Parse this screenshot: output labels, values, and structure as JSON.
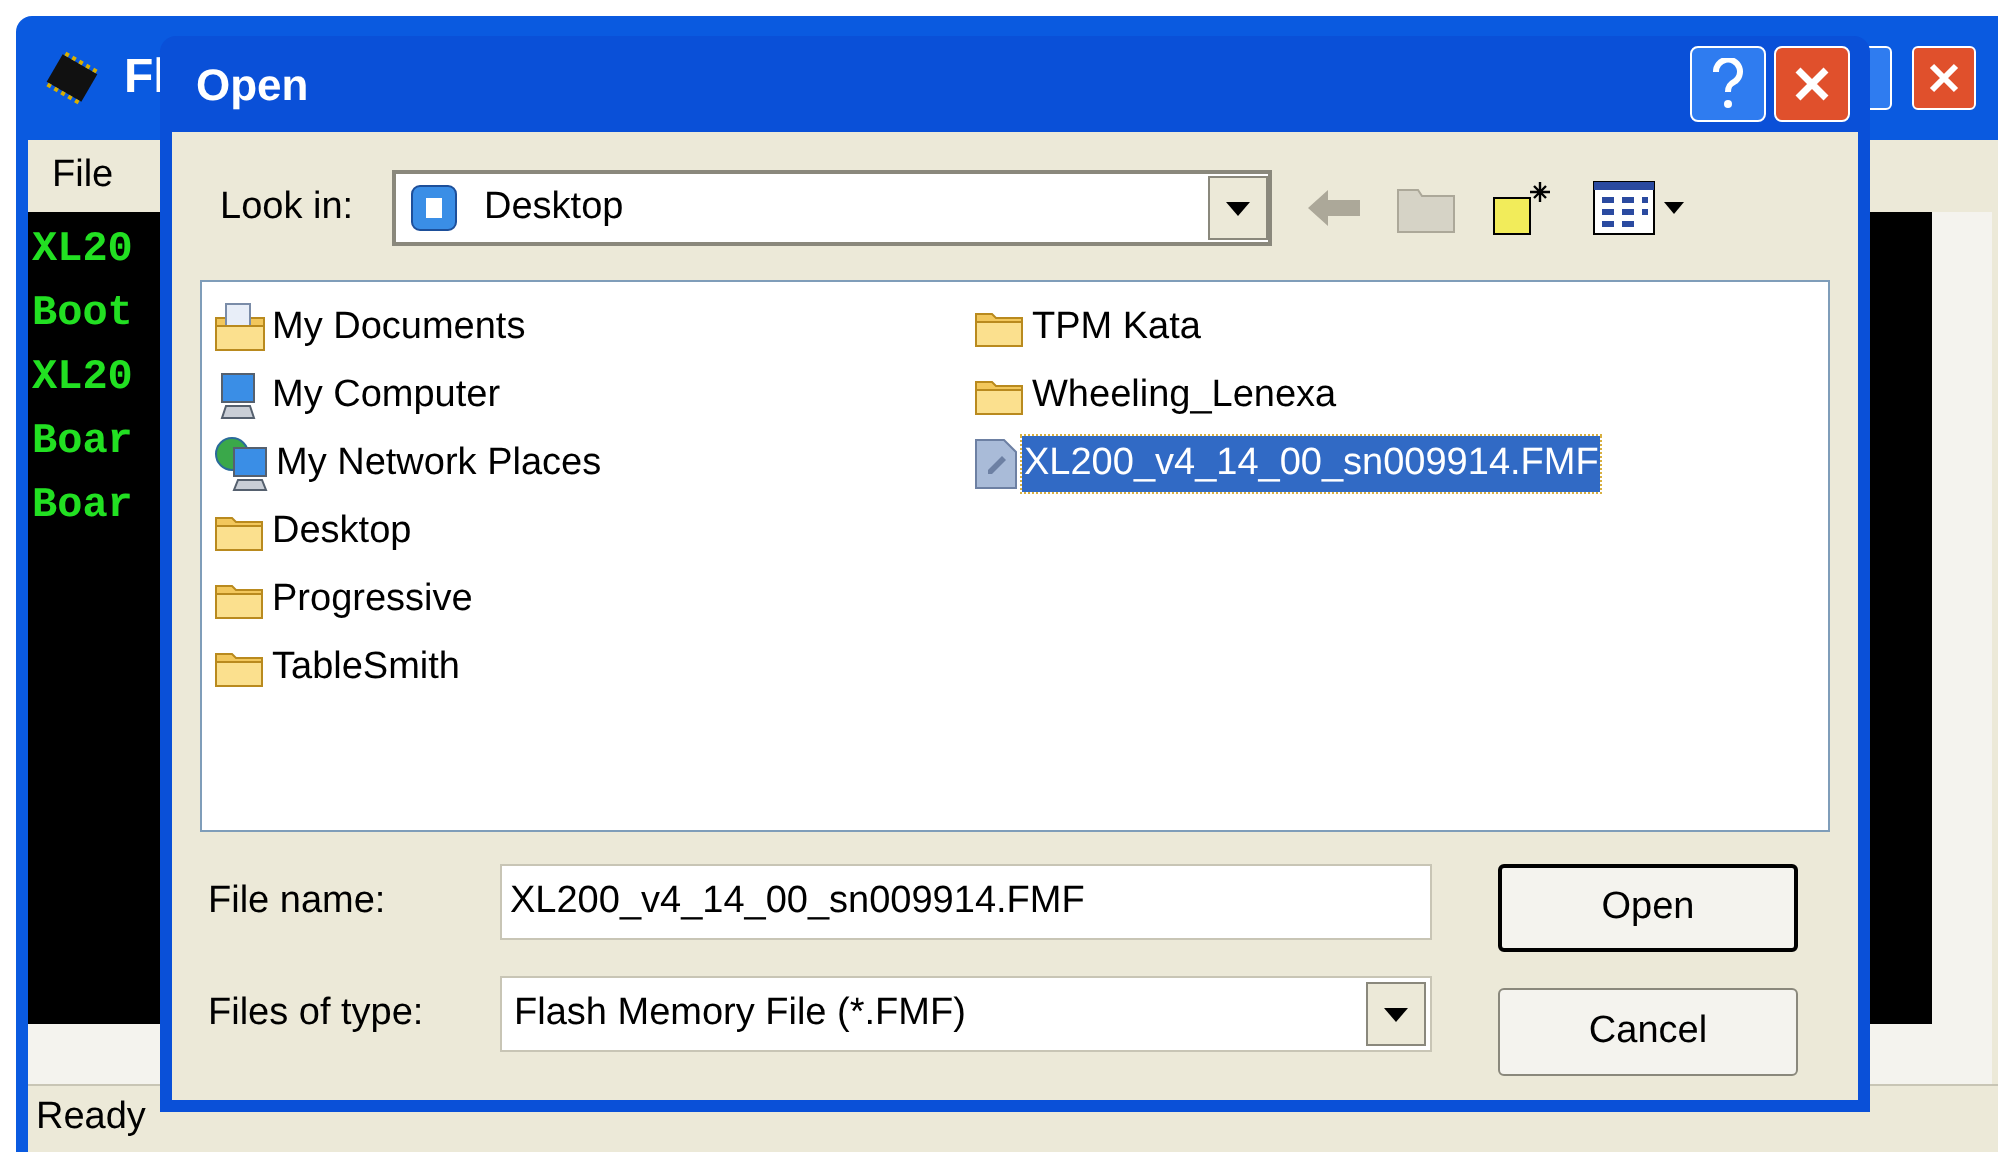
{
  "background_window": {
    "title": "Fl",
    "menu": [
      "File"
    ],
    "console_lines": [
      "XL20",
      "Boot",
      "XL20",
      "Boar",
      "Boar"
    ],
    "status_bar": "Ready"
  },
  "dialog": {
    "title": "Open",
    "look_in": {
      "label": "Look in:",
      "value": "Desktop"
    },
    "files": [
      {
        "name": "My Documents",
        "kind": "documents",
        "selected": false
      },
      {
        "name": "My Computer",
        "kind": "computer",
        "selected": false
      },
      {
        "name": "My Network Places",
        "kind": "network",
        "selected": false
      },
      {
        "name": "Desktop",
        "kind": "folder",
        "selected": false
      },
      {
        "name": "Progressive",
        "kind": "folder",
        "selected": false
      },
      {
        "name": "TableSmith",
        "kind": "folder",
        "selected": false
      },
      {
        "name": "TPM Kata",
        "kind": "folder",
        "selected": false
      },
      {
        "name": "Wheeling_Lenexa",
        "kind": "folder",
        "selected": false
      },
      {
        "name": "XL200_v4_14_00_sn009914.FMF",
        "kind": "file",
        "selected": true
      }
    ],
    "file_name": {
      "label": "File name:",
      "value": "XL200_v4_14_00_sn009914.FMF"
    },
    "file_type": {
      "label": "Files of type:",
      "value": "Flash Memory File (*.FMF)"
    },
    "buttons": [
      "Open",
      "Cancel"
    ]
  }
}
